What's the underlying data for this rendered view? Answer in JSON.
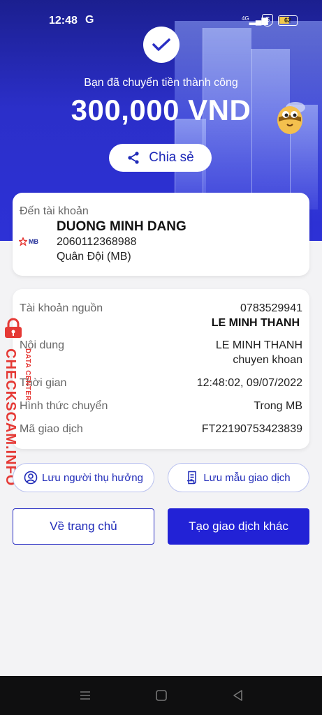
{
  "status_bar": {
    "time": "12:48",
    "carrier_icon": "G",
    "network": "4G",
    "shield": "S",
    "battery": "62",
    "battery_level": 0.62
  },
  "header": {
    "success_text": "Bạn đã chuyển tiền thành công",
    "amount": "300,000 VND",
    "share_label": "Chia sẻ"
  },
  "recipient": {
    "label": "Đến tài khoản",
    "bank_logo": "MB",
    "name": "DUONG MINH DANG",
    "account_number": "2060112368988",
    "bank": "Quân Đội (MB)"
  },
  "details": {
    "rows": [
      {
        "label": "Tài khoản nguồn",
        "value": "0783529941",
        "value2": "LE MINH THANH"
      },
      {
        "label": "Nội dung",
        "value": "LE MINH THANH",
        "value2": "chuyen khoan"
      },
      {
        "label": "Thời gian",
        "value": "12:48:02, 09/07/2022"
      },
      {
        "label": "Hình thức chuyển",
        "value": "Trong MB"
      },
      {
        "label": "Mã giao dịch",
        "value": "FT22190753423839"
      }
    ]
  },
  "actions": {
    "save_beneficiary": "Lưu người thụ hưởng",
    "save_template": "Lưu mẫu giao dịch",
    "home": "Về trang chủ",
    "new_transaction": "Tạo giao dịch khác"
  },
  "watermark": {
    "main": "CHECKSCAM.INFO",
    "sub": "DATA CENTER"
  },
  "colors": {
    "primary": "#2222d6",
    "accent_text": "#1f2ab8",
    "watermark": "#e53935"
  },
  "icons": [
    "check-icon",
    "share-icon",
    "user-circle-icon",
    "document-icon",
    "lock-icon",
    "menu-icon",
    "home-square-icon",
    "back-triangle-icon"
  ]
}
